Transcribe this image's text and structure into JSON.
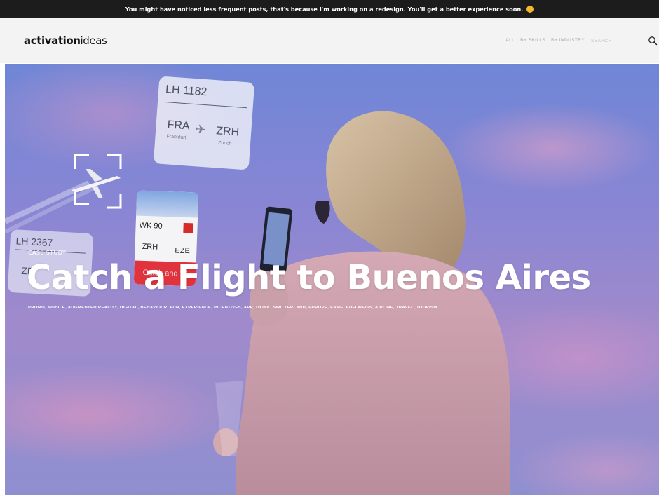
{
  "announcement": {
    "text": "You might have noticed less frequent posts, that's because I'm working on a redesign. You'll get a better experience soon.",
    "emoji": "smiling-face-icon"
  },
  "header": {
    "logo_bold": "activation",
    "logo_regular": "ideas",
    "nav": [
      "ALL",
      "BY SKILLS",
      "BY INDUSTRY"
    ],
    "search_placeholder": "SEARCH",
    "search_icon": "search-icon"
  },
  "hero": {
    "label": "CASE STUDY",
    "title": "Catch a Flight to Buenos Aires",
    "tags": [
      "PROMO",
      "MOBILE",
      "AUGMENTED REALITY",
      "DIGITAL",
      "BEHAVIOUR",
      "FUN",
      "EXPERIENCE",
      "INCENTIVES",
      "APP",
      "THJNK",
      "SWITZERLAND",
      "EUROPE",
      "EAME",
      "EDELWEISS",
      "AIRLINE",
      "TRAVEL",
      "TOURISM"
    ],
    "image": {
      "cards": {
        "lh1182": {
          "flight": "LH 1182",
          "from": "FRA",
          "from_city": "Frankfurt",
          "to": "ZRH",
          "to_city": "Zurich"
        },
        "wk90": {
          "flight": "WK 90",
          "from": "ZRH",
          "to": "EZE",
          "cta": "Catch and W"
        },
        "lh2367": {
          "flight": "LH 2367",
          "from": "ZR"
        }
      }
    }
  },
  "colors": {
    "announcement_bg": "#1c1c1c",
    "header_bg": "#f3f3f3",
    "nav_text": "#a6a6a6",
    "hero_sky": "#7f86d2",
    "cta_red": "#e0333d"
  }
}
